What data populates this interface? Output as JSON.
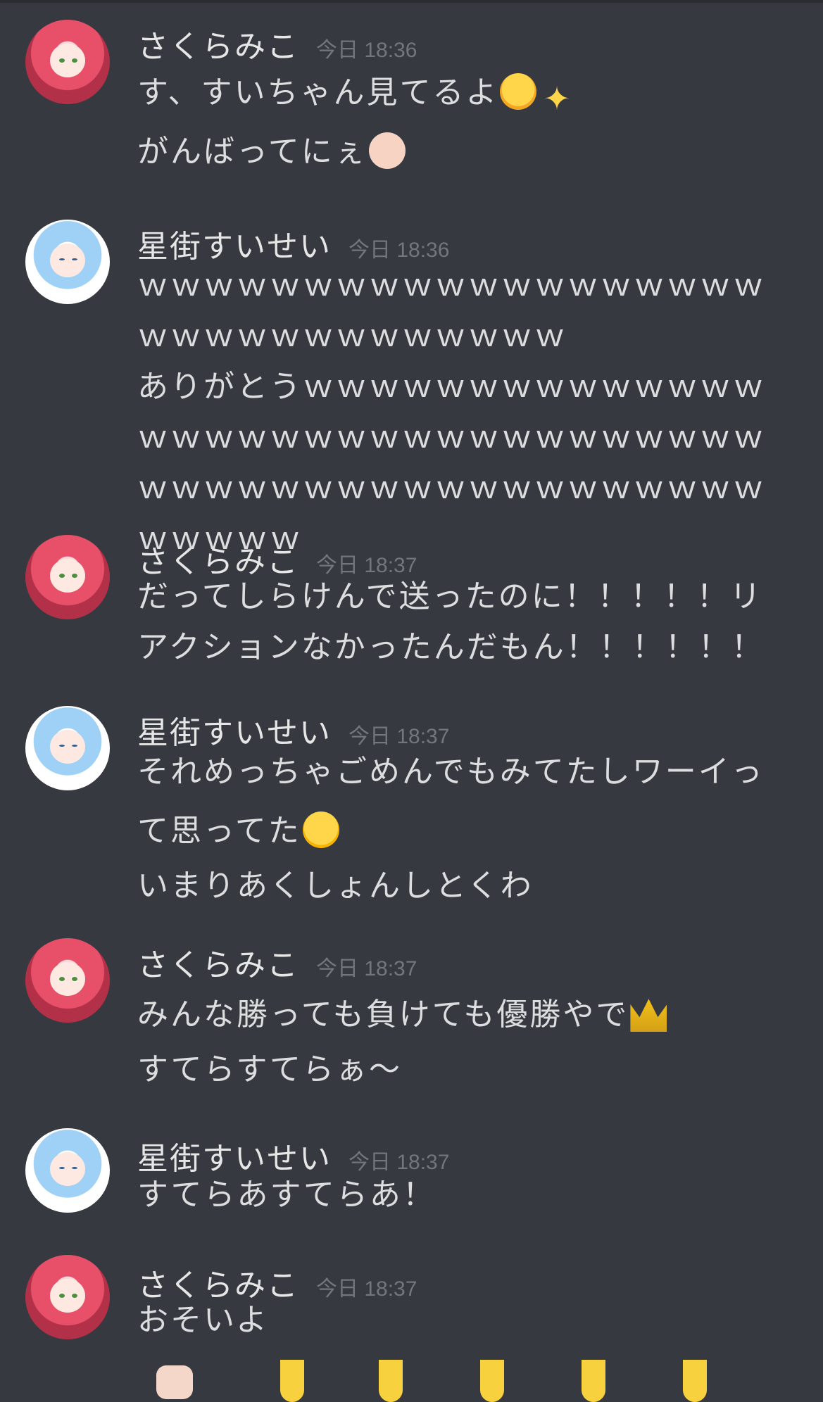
{
  "messages": [
    {
      "author": "さくらみこ",
      "time": "今日 18:36",
      "avatar": "miko",
      "lines": [
        "す、すいちゃん見てるよ",
        "がんばってにぇ"
      ],
      "emojis": [
        [
          "sweat-smile-icon",
          "sparkles-icon"
        ],
        [
          "baby-icon"
        ]
      ]
    },
    {
      "author": "星街すいせい",
      "time": "今日 18:36",
      "avatar": "suisei",
      "lines": [
        "ｗｗｗｗｗｗｗｗｗｗｗｗｗｗｗｗｗｗｗｗｗｗｗｗｗｗｗｗｗｗｗｗ",
        "ありがとうｗｗｗｗｗｗｗｗｗｗｗｗｗｗｗｗｗｗｗｗｗｗｗｗｗｗｗｗｗｗｗｗｗｗｗｗｗｗｗｗｗｗｗｗｗｗｗｗｗｗｗｗｗｗｗｗｗ"
      ],
      "emojis": [
        [],
        []
      ]
    },
    {
      "author": "さくらみこ",
      "time": "今日 18:37",
      "avatar": "miko",
      "lines": [
        "だってしらけんで送ったのに！！！！！リアクションなかったんだもん！！！！！！"
      ],
      "emojis": [
        []
      ]
    },
    {
      "author": "星街すいせい",
      "time": "今日 18:37",
      "avatar": "suisei",
      "lines": [
        "それめっちゃごめんでもみてたしワーイって思ってた",
        "いまりあくしょんしとくわ"
      ],
      "emojis": [
        [
          "grin-icon"
        ],
        []
      ]
    },
    {
      "author": "さくらみこ",
      "time": "今日 18:37",
      "avatar": "miko",
      "lines": [
        "みんな勝っても負けても優勝やで",
        "すてらすてらぁ～"
      ],
      "emojis": [
        [
          "crown-icon"
        ],
        []
      ]
    },
    {
      "author": "星街すいせい",
      "time": "今日 18:37",
      "avatar": "suisei",
      "lines": [
        "すてらあすてらあ！"
      ],
      "emojis": [
        []
      ]
    },
    {
      "author": "さくらみこ",
      "time": "今日 18:37",
      "avatar": "miko",
      "lines": [
        "おそいよ"
      ],
      "emojis": [
        []
      ]
    }
  ]
}
